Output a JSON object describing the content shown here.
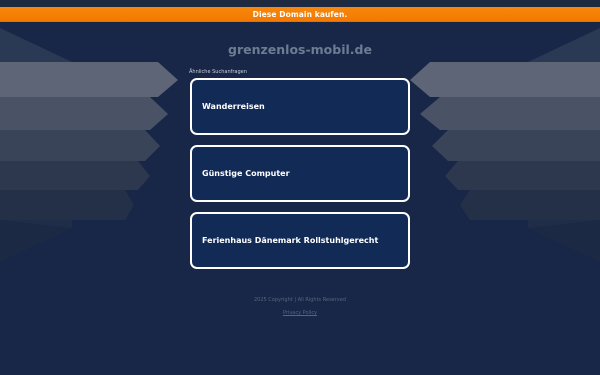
{
  "banner": {
    "text": "Diese Domain kaufen."
  },
  "header": {
    "domain": "grenzenlos-mobil.de"
  },
  "related": {
    "label": "Ähnliche Suchanfragen",
    "items": [
      {
        "label": "Wanderreisen"
      },
      {
        "label": "Günstige Computer"
      },
      {
        "label": "Ferienhaus Dänemark Rollstuhlgerecht"
      }
    ]
  },
  "footer": {
    "copyright": "2025 Copyright | All Rights Reserved",
    "privacy": "Privacy Policy"
  },
  "colors": {
    "background": "#182747",
    "banner": "#f47a00",
    "result_fill": "#112a56",
    "result_border": "#ffffff"
  }
}
